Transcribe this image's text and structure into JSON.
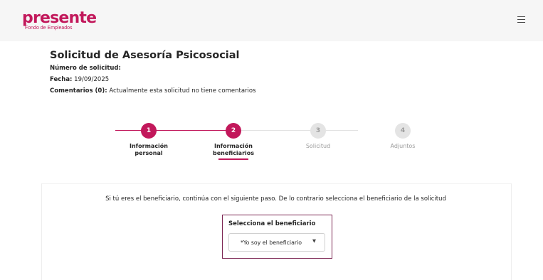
{
  "brand": {
    "name": "presente",
    "tagline": "Fondo de Empleados"
  },
  "header": {
    "menu_icon": "hamburger-menu-icon"
  },
  "page": {
    "title": "Solicitud de Asesoría Psicosocial",
    "request_number_label": "Número de solicitud:",
    "request_number_value": "",
    "date_label": "Fecha:",
    "date_value": "19/09/2025",
    "comments_label": "Comentarios (0):",
    "comments_value": "Actualmente esta solicitud no tiene comentarios"
  },
  "stepper": {
    "current_step": 2,
    "steps": [
      {
        "number": "1",
        "line1": "Información",
        "line2": "personal",
        "state": "completed"
      },
      {
        "number": "2",
        "line1": "Información",
        "line2": "beneficiarios",
        "state": "current"
      },
      {
        "number": "3",
        "line1": "Solicitud",
        "line2": "",
        "state": "pending"
      },
      {
        "number": "4",
        "line1": "Adjuntos",
        "line2": "",
        "state": "pending"
      }
    ]
  },
  "form": {
    "instruction": "Si tú eres el beneficiario, continúa con el siguiente paso. De lo contrario selecciona el beneficiario de la solicitud",
    "beneficiary_label": "Selecciona el beneficiario",
    "beneficiary_selected": "*Yo soy el beneficiario",
    "dropdown_icon": "caret-down-icon"
  },
  "colors": {
    "accent": "#c2185b",
    "border_focus": "#7b2451",
    "inactive": "#e4e4e4",
    "header_bg": "#f6f6f6"
  }
}
